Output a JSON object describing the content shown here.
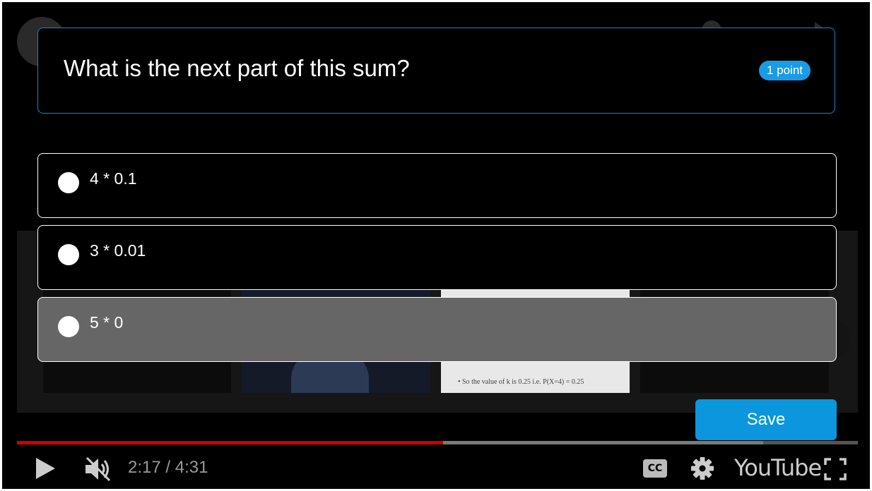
{
  "question": {
    "text": "What is the next part of this sum?",
    "points": "1 point"
  },
  "options": [
    {
      "label": "4 * 0.1",
      "selected": false,
      "hovered": false
    },
    {
      "label": "3 * 0.01",
      "selected": false,
      "hovered": false
    },
    {
      "label": "5 * 0",
      "selected": false,
      "hovered": true
    }
  ],
  "save_label": "Save",
  "background_slide_text": "•  So the value of k is 0.25     i.e. P(X=4) = 0.25",
  "player": {
    "time": "2:17 / 4:31",
    "played_fraction": 0.507,
    "loaded_fraction": 0.887,
    "cc_label": "CC",
    "brand": "YouTube"
  },
  "colors": {
    "accent": "#0b96de",
    "question_border": "#1a86d0",
    "progress_played": "#cc0000",
    "hovered_option": "#666666"
  }
}
